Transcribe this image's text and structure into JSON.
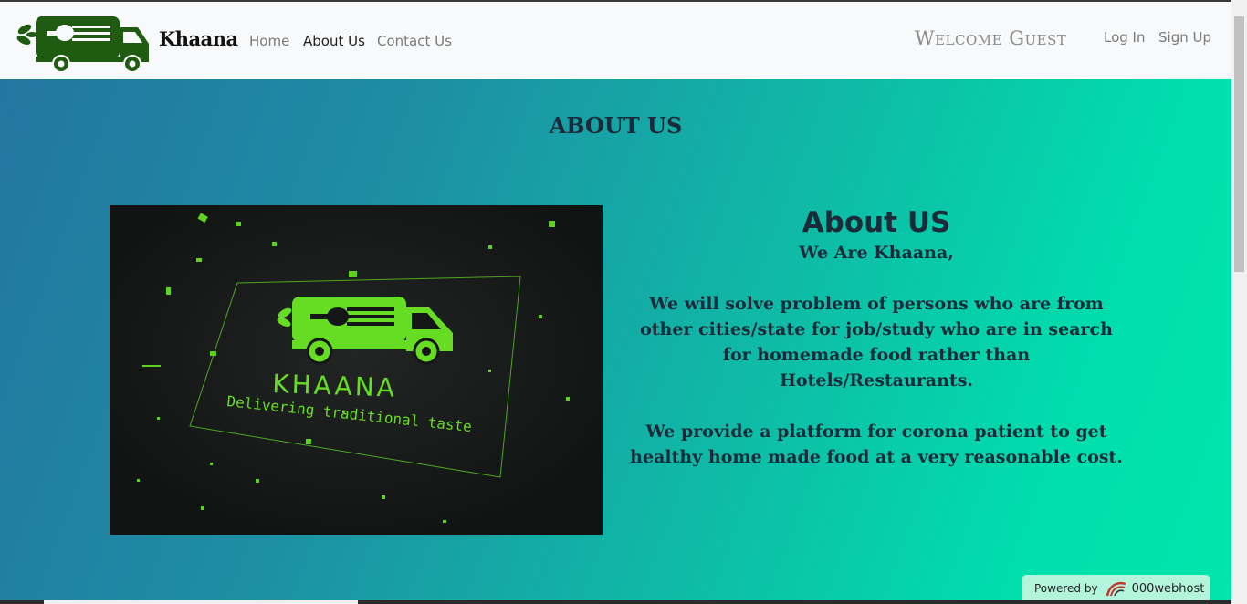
{
  "brand": {
    "name": "Khaana",
    "logo_icon": "food-truck-icon",
    "logo_color": "#1f5c12"
  },
  "nav": {
    "links": [
      {
        "label": "Home",
        "active": false
      },
      {
        "label": "About Us",
        "active": true
      },
      {
        "label": "Contact Us",
        "active": false
      }
    ],
    "welcome_text": "Welcome Guest",
    "login_label": "Log In",
    "signup_label": "Sign Up"
  },
  "about": {
    "section_title": "ABOUT US",
    "image": {
      "brand_text": "KHAANA",
      "tagline": "Delivering traditional taste",
      "accent_color": "#5fd21e"
    },
    "heading": "About US",
    "paragraph1": "We Are Khaana,",
    "paragraph2": "We will solve problem of persons who are from\nother cities/state for job/study who are in search\nfor homemade food rather than\nHotels/Restaurants.",
    "paragraph3": "We provide a platform for corona patient to get\nhealthy home made food at a very reasonable cost."
  },
  "footer": {
    "powered_by": "Powered by",
    "host_name": "000webhost"
  },
  "colors": {
    "gradient_start": "#2376a0",
    "gradient_end": "#00e5ab",
    "navbar_bg": "#f8f9fa",
    "text_dark": "#1b2b3a"
  }
}
